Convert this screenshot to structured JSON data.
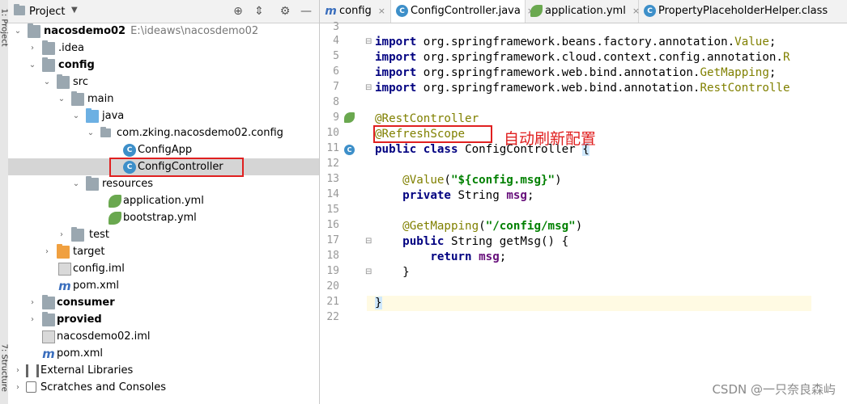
{
  "vertical_tabs": {
    "project": "1: Project",
    "structure": "7: Structure"
  },
  "project_panel": {
    "title": "Project"
  },
  "tree": [
    {
      "label": "nacosdemo02",
      "path": "E:\\ideaws\\nacosdemo02",
      "bold": true
    },
    {
      "label": ".idea"
    },
    {
      "label": "config",
      "bold": true
    },
    {
      "label": "src"
    },
    {
      "label": "main"
    },
    {
      "label": "java"
    },
    {
      "label": "com.zking.nacosdemo02.config"
    },
    {
      "label": "ConfigApp"
    },
    {
      "label": "ConfigController"
    },
    {
      "label": "resources"
    },
    {
      "label": "application.yml"
    },
    {
      "label": "bootstrap.yml"
    },
    {
      "label": "test"
    },
    {
      "label": "target"
    },
    {
      "label": "config.iml"
    },
    {
      "label": "pom.xml"
    },
    {
      "label": "consumer",
      "bold": true
    },
    {
      "label": "provied",
      "bold": true
    },
    {
      "label": "nacosdemo02.iml"
    },
    {
      "label": "pom.xml"
    },
    {
      "label": "External Libraries"
    },
    {
      "label": "Scratches and Consoles"
    }
  ],
  "editor_tabs": [
    {
      "label": "config",
      "active": false
    },
    {
      "label": "ConfigController.java",
      "active": true
    },
    {
      "label": "application.yml",
      "active": false
    },
    {
      "label": "PropertyPlaceholderHelper.class",
      "active": false
    }
  ],
  "code": {
    "line_numbers": [
      "3",
      "4",
      "5",
      "6",
      "7",
      "8",
      "9",
      "10",
      "11",
      "12",
      "13",
      "14",
      "15",
      "16",
      "17",
      "18",
      "19",
      "20",
      "21",
      "22"
    ],
    "imports": [
      {
        "pkg": "org.springframework.beans.factory.annotation.",
        "cls": "Value",
        "end": ";"
      },
      {
        "pkg": "org.springframework.cloud.context.config.annotation.",
        "cls": "R",
        "end": ""
      },
      {
        "pkg": "org.springframework.web.bind.annotation.",
        "cls": "GetMapping",
        "end": ";"
      },
      {
        "pkg": "org.springframework.web.bind.annotation.",
        "cls": "RestControlle",
        "end": ""
      }
    ],
    "kw_import": "import",
    "ann_restcontroller": "@RestController",
    "ann_refreshscope": "@RefreshScope",
    "kw_public": "public",
    "kw_class": "class",
    "class_name": "ConfigController",
    "brace_open": "{",
    "brace_close": "}",
    "ann_value": "@Value",
    "value_arg": "\"${config.msg}\"",
    "kw_private": "private",
    "type_string": "String",
    "field_msg": "msg",
    "ann_getmapping": "@GetMapping",
    "mapping_arg": "\"/config/msg\"",
    "method_sig": "getMsg() {",
    "kw_return": "return",
    "semicolon": ";",
    "paren_open": "(",
    "paren_close": ")"
  },
  "annotation_note": "自动刷新配置",
  "watermark": "CSDN @一只奈良森屿",
  "colors": {
    "highlight_red": "#e02020",
    "selection": "#d5d5d5"
  }
}
